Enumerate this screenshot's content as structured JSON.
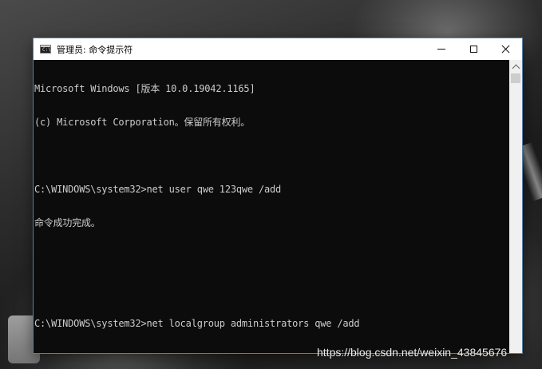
{
  "window": {
    "title": "管理员: 命令提示符",
    "app_icon": "cmd-icon",
    "app_icon_text": "C:\\",
    "controls": {
      "minimize": "minimize-icon",
      "maximize": "maximize-icon",
      "close": "close-icon"
    }
  },
  "console": {
    "lines": [
      "Microsoft Windows [版本 10.0.19042.1165]",
      "(c) Microsoft Corporation。保留所有权利。",
      "",
      "C:\\WINDOWS\\system32>net user qwe 123qwe /add",
      "命令成功完成。",
      "",
      "",
      "C:\\WINDOWS\\system32>net localgroup administrators qwe /add"
    ]
  },
  "watermark": {
    "text": "https://blog.csdn.net/weixin_43845676"
  },
  "colors": {
    "console_bg": "#0c0c0c",
    "console_text": "#cccccc",
    "title_bar_bg": "#ffffff",
    "scrollbar_bg": "#f0f0f0"
  }
}
